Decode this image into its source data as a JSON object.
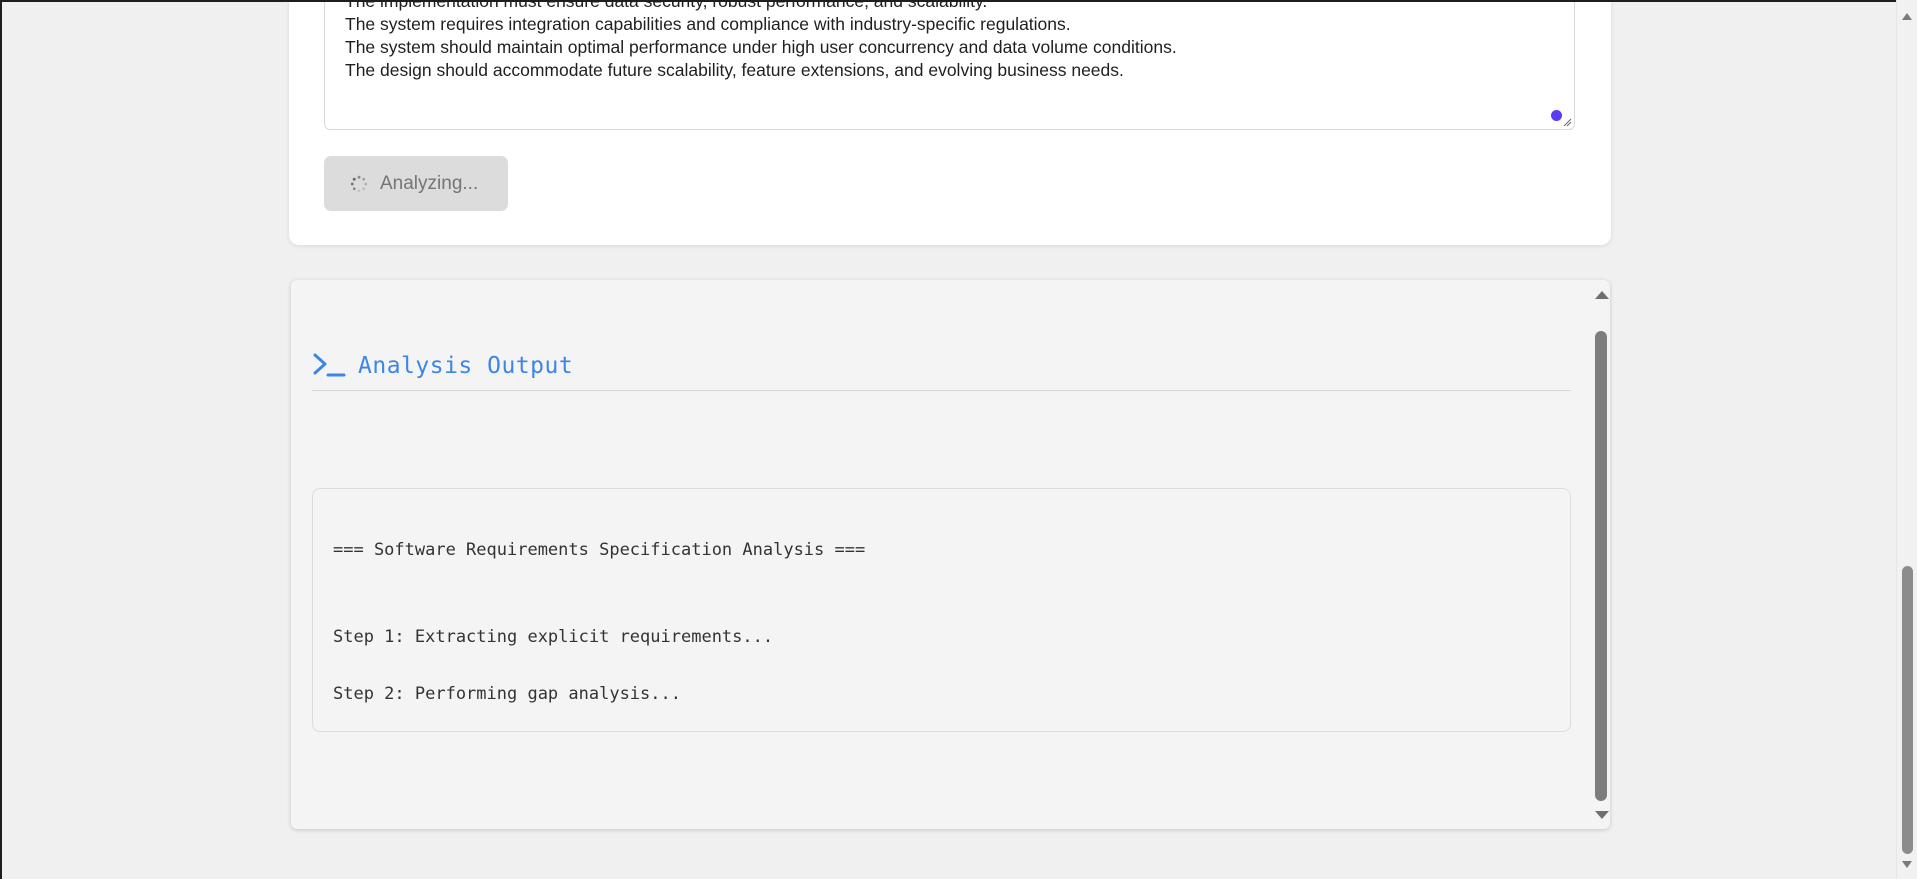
{
  "requirements_input": {
    "lines": [
      "The implementation must ensure data security, robust performance, and scalability.",
      "The system requires integration capabilities and compliance with industry-specific regulations.",
      "The system should maintain optimal performance under high user concurrency and data volume conditions.",
      "The design should accommodate future scalability, feature extensions, and evolving business needs."
    ]
  },
  "analyze_button": {
    "label": "Analyzing...",
    "state": "loading"
  },
  "output": {
    "title": "Analysis Output",
    "icon": "terminal-icon",
    "log": [
      "=== Software Requirements Specification Analysis ===",
      "Step 1: Extracting explicit requirements...",
      "Step 2: Performing gap analysis..."
    ]
  },
  "colors": {
    "accent": "#3d86e6",
    "resize_dot": "#5b3df5",
    "button_disabled_bg": "#dcdcdc"
  }
}
